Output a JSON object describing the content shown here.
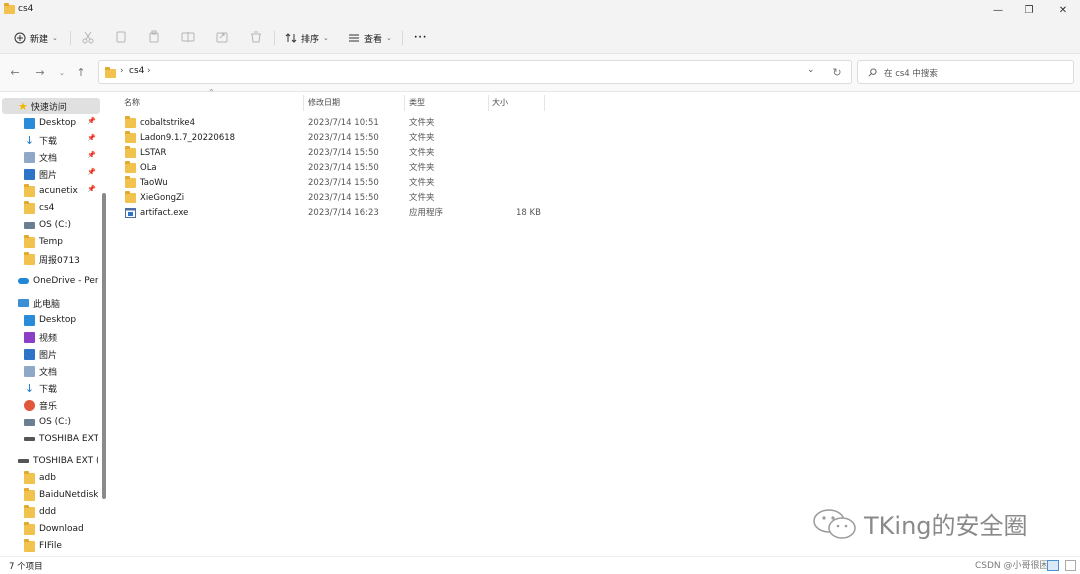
{
  "window": {
    "title": "cs4",
    "minimize": "—",
    "maximize": "❐",
    "close": "✕"
  },
  "toolbar": {
    "new_label": "新建",
    "sort_label": "排序",
    "view_label": "查看",
    "more_label": "···"
  },
  "address": {
    "path_root": "cs4",
    "separator": "›"
  },
  "search": {
    "placeholder": "在 cs4 中搜索"
  },
  "sidebar": {
    "quick_access": "快速访问",
    "items": [
      {
        "label": "Desktop",
        "icon": "desktop-icon",
        "pinned": true
      },
      {
        "label": "下载",
        "icon": "download-icon",
        "pinned": true
      },
      {
        "label": "文档",
        "icon": "document-icon",
        "pinned": true
      },
      {
        "label": "图片",
        "icon": "pictures-icon",
        "pinned": true
      },
      {
        "label": "acunetix",
        "icon": "folder-icon",
        "pinned": true
      },
      {
        "label": "cs4",
        "icon": "folder-icon",
        "pinned": false
      },
      {
        "label": "OS (C:)",
        "icon": "drive-icon",
        "pinned": false
      },
      {
        "label": "Temp",
        "icon": "folder-icon",
        "pinned": false
      },
      {
        "label": "周报0713",
        "icon": "folder-icon",
        "pinned": false
      }
    ],
    "onedrive": "OneDrive - Perso",
    "this_pc": "此电脑",
    "pc_items": [
      {
        "label": "Desktop",
        "icon": "desktop-icon"
      },
      {
        "label": "视频",
        "icon": "video-icon"
      },
      {
        "label": "图片",
        "icon": "pictures-icon"
      },
      {
        "label": "文档",
        "icon": "document-icon"
      },
      {
        "label": "下载",
        "icon": "download-icon"
      },
      {
        "label": "音乐",
        "icon": "music-icon"
      },
      {
        "label": "OS (C:)",
        "icon": "drive-icon"
      },
      {
        "label": "TOSHIBA EXT (",
        "icon": "external-drive-icon"
      }
    ],
    "toshiba": "TOSHIBA EXT (D",
    "toshiba_items": [
      {
        "label": "adb",
        "icon": "folder-icon"
      },
      {
        "label": "BaiduNetdiskD",
        "icon": "folder-icon"
      },
      {
        "label": "ddd",
        "icon": "folder-icon"
      },
      {
        "label": "Download",
        "icon": "folder-icon"
      },
      {
        "label": "FIFile",
        "icon": "folder-icon"
      }
    ]
  },
  "columns": {
    "name": "名称",
    "modified": "修改日期",
    "type": "类型",
    "size": "大小"
  },
  "files": [
    {
      "name": "cobaltstrike4",
      "modified": "2023/7/14 10:51",
      "type": "文件夹",
      "size": "",
      "kind": "folder"
    },
    {
      "name": "Ladon9.1.7_20220618",
      "modified": "2023/7/14 15:50",
      "type": "文件夹",
      "size": "",
      "kind": "folder"
    },
    {
      "name": "LSTAR",
      "modified": "2023/7/14 15:50",
      "type": "文件夹",
      "size": "",
      "kind": "folder"
    },
    {
      "name": "OLa",
      "modified": "2023/7/14 15:50",
      "type": "文件夹",
      "size": "",
      "kind": "folder"
    },
    {
      "name": "TaoWu",
      "modified": "2023/7/14 15:50",
      "type": "文件夹",
      "size": "",
      "kind": "folder"
    },
    {
      "name": "XieGongZi",
      "modified": "2023/7/14 15:50",
      "type": "文件夹",
      "size": "",
      "kind": "folder"
    },
    {
      "name": "artifact.exe",
      "modified": "2023/7/14 16:23",
      "type": "应用程序",
      "size": "18 KB",
      "kind": "exe"
    }
  ],
  "status": {
    "count": "7 个项目"
  },
  "watermark": {
    "text": "TKing的安全圈",
    "csdn": "CSDN @小哥很困"
  },
  "colors": {
    "accent": "#0067c0",
    "folder": "#f2c24f",
    "selected": "#e5e5e5"
  }
}
